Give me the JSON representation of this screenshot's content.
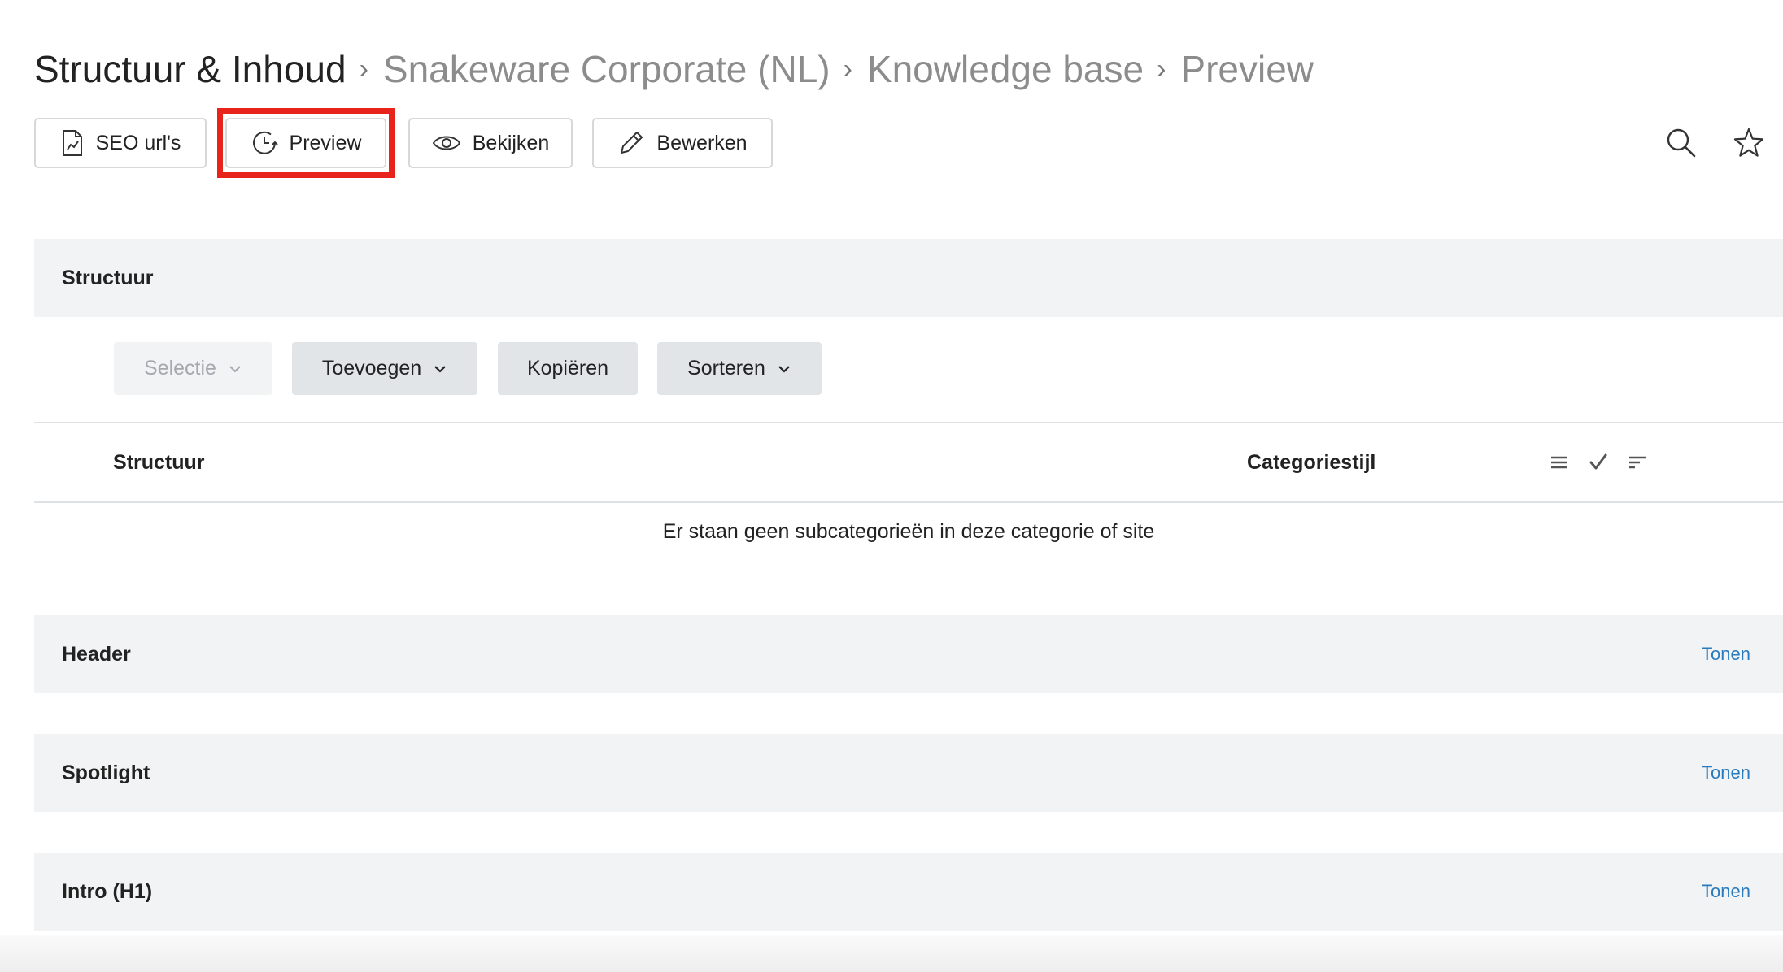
{
  "breadcrumb": {
    "root": "Structuur & Inhoud",
    "separator": "›",
    "items": [
      "Snakeware Corporate (NL)",
      "Knowledge base",
      "Preview"
    ]
  },
  "toolbar": {
    "seo_label": "SEO url's",
    "preview_label": "Preview",
    "view_label": "Bekijken",
    "edit_label": "Bewerken"
  },
  "top_icons": [
    "search-icon",
    "star-icon"
  ],
  "structure_panel": {
    "title": "Structuur",
    "actions": {
      "selection": "Selectie",
      "add": "Toevoegen",
      "copy": "Kopiëren",
      "sort": "Sorteren"
    },
    "columns": {
      "structure": "Structuur",
      "category_style": "Categoriestijl"
    },
    "empty_message": "Er staan geen subcategorieën in deze categorie of site"
  },
  "sections": [
    {
      "title": "Header",
      "link": "Tonen"
    },
    {
      "title": "Spotlight",
      "link": "Tonen"
    },
    {
      "title": "Intro (H1)",
      "link": "Tonen"
    }
  ],
  "colors": {
    "highlight": "#e8231c",
    "link": "#2a7bbd",
    "panel_bg": "#f1f3f4",
    "button_bg": "#e2e5e8"
  }
}
